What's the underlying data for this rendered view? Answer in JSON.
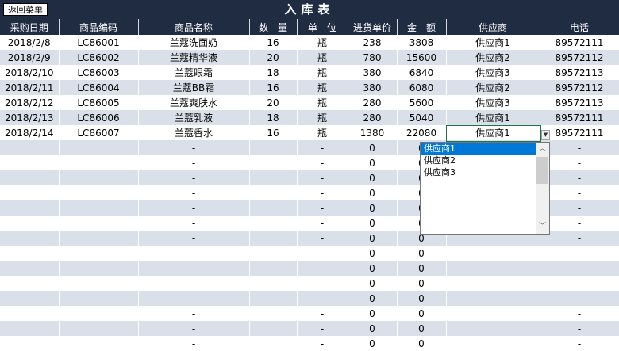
{
  "header": {
    "title": "入库表",
    "back_button": "返回菜单"
  },
  "columns": [
    "采购日期",
    "商品编码",
    "商品名称",
    "数　量",
    "单　位",
    "进货单价",
    "金　额",
    "供应商",
    "电话"
  ],
  "rows": [
    [
      "2018/2/8",
      "LC86001",
      "兰蔻洗面奶",
      "16",
      "瓶",
      "238",
      "3808",
      "供应商1",
      "89572111"
    ],
    [
      "2018/2/9",
      "LC86002",
      "兰蔻精华液",
      "20",
      "瓶",
      "780",
      "15600",
      "供应商2",
      "89572112"
    ],
    [
      "2018/2/10",
      "LC86003",
      "兰蔻眼霜",
      "18",
      "瓶",
      "380",
      "6840",
      "供应商3",
      "89572113"
    ],
    [
      "2018/2/11",
      "LC86004",
      "兰蔻BB霜",
      "16",
      "瓶",
      "380",
      "6080",
      "供应商2",
      "89572112"
    ],
    [
      "2018/2/12",
      "LC86005",
      "兰蔻爽肤水",
      "20",
      "瓶",
      "280",
      "5600",
      "供应商3",
      "89572113"
    ],
    [
      "2018/2/13",
      "LC86006",
      "兰蔻乳液",
      "18",
      "瓶",
      "280",
      "5040",
      "供应商1",
      "89572111"
    ],
    [
      "2018/2/14",
      "LC86007",
      "兰蔻香水",
      "16",
      "瓶",
      "1380",
      "22080",
      "供应商1",
      "89572111"
    ],
    [
      "",
      "",
      "-",
      "",
      "-",
      "0",
      "0",
      "",
      "-"
    ],
    [
      "",
      "",
      "-",
      "",
      "-",
      "0",
      "0",
      "",
      "-"
    ],
    [
      "",
      "",
      "-",
      "",
      "-",
      "0",
      "0",
      "",
      "-"
    ],
    [
      "",
      "",
      "-",
      "",
      "-",
      "0",
      "0",
      "",
      "-"
    ],
    [
      "",
      "",
      "-",
      "",
      "-",
      "0",
      "0",
      "",
      "-"
    ],
    [
      "",
      "",
      "-",
      "",
      "-",
      "0",
      "0",
      "",
      "-"
    ],
    [
      "",
      "",
      "-",
      "",
      "-",
      "0",
      "0",
      "",
      "-"
    ],
    [
      "",
      "",
      "-",
      "",
      "-",
      "0",
      "0",
      "",
      "-"
    ],
    [
      "",
      "",
      "-",
      "",
      "-",
      "0",
      "0",
      "",
      "-"
    ],
    [
      "",
      "",
      "-",
      "",
      "-",
      "0",
      "0",
      "",
      "-"
    ],
    [
      "",
      "",
      "-",
      "",
      "-",
      "0",
      "0",
      "",
      "-"
    ],
    [
      "",
      "",
      "-",
      "",
      "-",
      "0",
      "0",
      "",
      "-"
    ],
    [
      "",
      "",
      "-",
      "",
      "-",
      "0",
      "0",
      "",
      "-"
    ],
    [
      "",
      "",
      "-",
      "",
      "-",
      "0",
      "0",
      "",
      "-"
    ]
  ],
  "dropdown": {
    "options": [
      "供应商1",
      "供应商2",
      "供应商3"
    ],
    "selected": "供应商1"
  },
  "colors": {
    "header_bg": "#1f2c42",
    "stripe": "#d9e0ea",
    "selection": "#0078d7"
  }
}
